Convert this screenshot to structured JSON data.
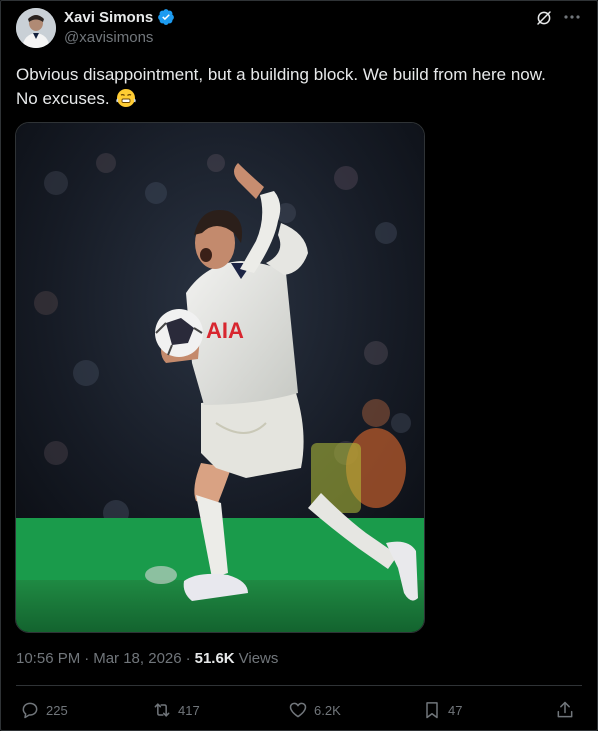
{
  "author": {
    "name": "Xavi Simons",
    "handle": "@xavisimons",
    "verified": true
  },
  "icons": {
    "verified": "verified-badge-icon",
    "grok": "grok-icon",
    "more": "more-horizontal-icon",
    "reply": "reply-icon",
    "retweet": "retweet-icon",
    "like": "heart-icon",
    "bookmark": "bookmark-icon",
    "share": "share-icon"
  },
  "colors": {
    "background": "#000000",
    "text": "#e7e9ea",
    "muted": "#71767b",
    "verified_blue": "#1d9bf0",
    "border": "#2f3336"
  },
  "tweet": {
    "text_line1": "Obvious disappointment, but a building block. We build from here now.",
    "text_line2": "No excuses.",
    "emoji": "😤",
    "media": {
      "description_hidden": ""
    }
  },
  "meta": {
    "time": "10:56 PM",
    "separator": "·",
    "date": "Mar 18, 2026",
    "separator2": "·",
    "views_count": "51.6K",
    "views_label": "Views"
  },
  "actions": {
    "replies": "225",
    "retweets": "417",
    "likes": "6.2K",
    "bookmarks": "47"
  }
}
